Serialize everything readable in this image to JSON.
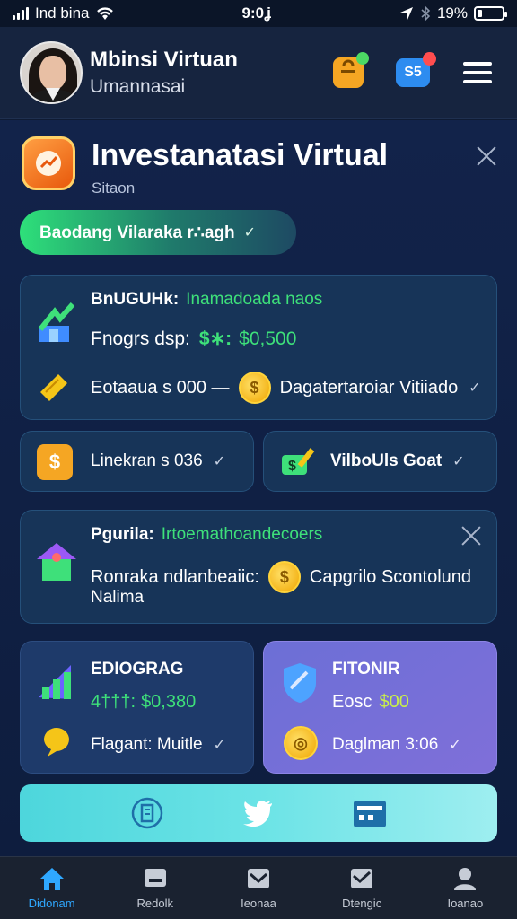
{
  "status_bar": {
    "carrier": "Ind bina",
    "time": "9:0ʝ",
    "battery_text": "19%",
    "battery_level": 0.19
  },
  "header": {
    "name": "Mbinsi Virtuan",
    "subtitle": "Umannasai",
    "icons": [
      "shopping-bag-icon",
      "chat-badge-icon",
      "menu-icon"
    ],
    "chat_badge_text": "S5"
  },
  "panel": {
    "title": "Investanatasi Virtual",
    "subtitle": "Sitaon",
    "status_pill": "Baodang Vilaraka r∴agh"
  },
  "cards": {
    "overview": {
      "heading_label": "BnUGUHk:",
      "heading_value": "Inamadoada naos",
      "line1_label": "Fnogrs dsp:",
      "line1_symbol": "$∗:",
      "line1_amount": "$0,500",
      "line2_label": "Eotaaua s 000 —",
      "line2_coin": "$",
      "line2_value": "Dagatertaroiar Vitiiado"
    },
    "left_small": {
      "label": "Linekran s 036"
    },
    "right_small": {
      "label": "VilboUls Goat"
    },
    "program": {
      "heading_label": "Pgurila:",
      "heading_value": "Irtoemathoandecoers",
      "line1_label": "Ronraka ndlanbeaiic:",
      "line1_coin": "$",
      "line1_value": "Capgrilo Scontolund",
      "line2_label": "Nalima"
    },
    "left_tile": {
      "title": "EDIOGRAG",
      "value_label": "4†††:",
      "value_amount": "$0,380",
      "footer": "Flagant: Muitle"
    },
    "right_tile": {
      "title": "FITONIR",
      "value_label": "Eosc",
      "value_amount": "$00",
      "footer": "Daglman 3:06"
    }
  },
  "social": [
    "receipt-icon",
    "twitter-icon",
    "wallet-icon"
  ],
  "bottom_nav": [
    {
      "label": "Didonam",
      "icon": "home-icon",
      "active": true
    },
    {
      "label": "Redolk",
      "icon": "chart-icon",
      "active": false
    },
    {
      "label": "Ieonaa",
      "icon": "inbox-icon",
      "active": false
    },
    {
      "label": "Dtengic",
      "icon": "image-icon",
      "active": false
    },
    {
      "label": "Ioanao",
      "icon": "profile-icon",
      "active": false
    }
  ],
  "colors": {
    "accent_green": "#3ee07a",
    "accent_lime": "#c9f04a",
    "nav_active": "#2fa8ff",
    "panel_bg": "#12234a"
  }
}
